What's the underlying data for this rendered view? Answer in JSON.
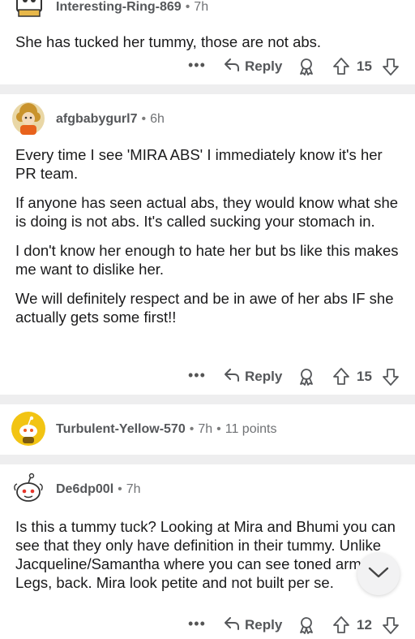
{
  "comments": [
    {
      "author": "Interesting-Ring-869",
      "time": "7h",
      "paragraphs": [
        "She has tucked her tummy, those are not abs."
      ],
      "reply_label": "Reply",
      "score": "15"
    },
    {
      "author": "afgbabygurl7",
      "time": "6h",
      "paragraphs": [
        "Every time I see 'MIRA ABS'  I immediately know it's her PR team.",
        "If anyone has seen actual abs, they would know what she is doing is not abs. It's called sucking your stomach in.",
        "I don't know her enough to hate her but bs like this makes me want to dislike her.",
        "We will definitely respect and be in awe of her abs IF she actually gets some first!!"
      ],
      "reply_label": "Reply",
      "score": "15"
    },
    {
      "author": "Turbulent-Yellow-570",
      "time": "7h",
      "points": "11 points",
      "collapsed": true
    },
    {
      "author": "De6dp00l",
      "time": "7h",
      "paragraphs": [
        "Is this a tummy tuck? Looking at Mira and Bhumi you can see that they only have definition in their tummy. Unlike Jacqueline/Samantha where you can see toned arms, Legs, back. Mira look petite and not built per se."
      ],
      "reply_label": "Reply",
      "score": "12"
    }
  ],
  "more_glyph": "•••",
  "icons": {
    "more": "more-options-icon",
    "reply": "reply-arrow-icon",
    "award": "award-icon",
    "upvote": "upvote-arrow-icon",
    "downvote": "downvote-arrow-icon",
    "scroll": "chevron-down-icon"
  },
  "colors": {
    "divider": "#eeeeef",
    "text": "#1a1a1b",
    "meta": "#55575a",
    "yellow_avatar": "#f2c413"
  }
}
